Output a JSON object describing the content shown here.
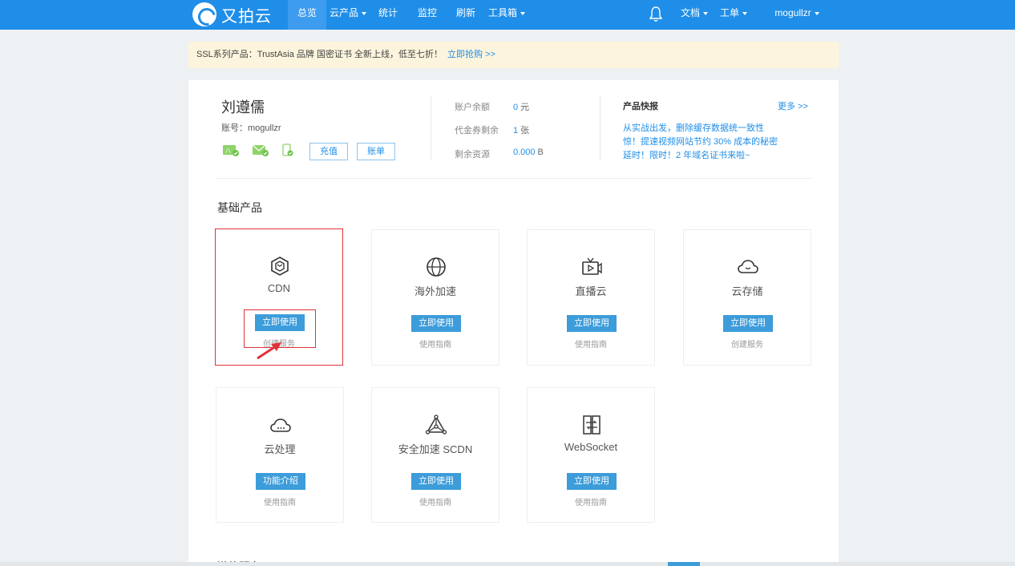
{
  "brand": {
    "name": "又拍云"
  },
  "nav": {
    "items": [
      {
        "label": "总览",
        "active": true,
        "dropdown": false
      },
      {
        "label": "云产品",
        "active": false,
        "dropdown": true
      },
      {
        "label": "统计",
        "active": false,
        "dropdown": false
      },
      {
        "label": "监控",
        "active": false,
        "dropdown": false
      },
      {
        "label": "刷新",
        "active": false,
        "dropdown": false
      },
      {
        "label": "工具箱",
        "active": false,
        "dropdown": true
      }
    ],
    "right": [
      {
        "label": "文档",
        "dropdown": true
      },
      {
        "label": "工单",
        "dropdown": true
      },
      {
        "label": "mogullzr",
        "dropdown": true
      }
    ]
  },
  "notice": {
    "text": "SSL系列产品：TrustAsia 品牌 国密证书 全新上线，低至七折！",
    "link": "立即抢购 >>"
  },
  "user": {
    "name": "刘遵儒",
    "account": "账号：mogullzr",
    "recharge_label": "充值",
    "bill_label": "账单"
  },
  "stats": [
    {
      "label": "账户余额",
      "value": "0",
      "unit": "元"
    },
    {
      "label": "代金券剩余",
      "value": "1",
      "unit": "张"
    },
    {
      "label": "剩余资源",
      "value": "0.000",
      "unit": "B"
    }
  ],
  "news": {
    "title": "产品快报",
    "more": "更多 >>",
    "lines": [
      "从实战出发，删除缓存数据统一致性",
      "惊！提速视频网站节约 30% 成本的秘密",
      "延时！限时！2 年域名证书来啦~"
    ]
  },
  "section": {
    "title": "基础产品"
  },
  "products": [
    {
      "name": "CDN",
      "button": "立即使用",
      "sub": "创建服务",
      "icon": "cdn-icon"
    },
    {
      "name": "海外加速",
      "button": "立即使用",
      "sub": "使用指南",
      "icon": "globe-icon"
    },
    {
      "name": "直播云",
      "button": "立即使用",
      "sub": "使用指南",
      "icon": "tv-icon"
    },
    {
      "name": "云存储",
      "button": "立即使用",
      "sub": "创建服务",
      "icon": "cloud-icon"
    },
    {
      "name": "云处理",
      "button": "功能介绍",
      "sub": "使用指南",
      "icon": "cloud-process-icon"
    },
    {
      "name": "安全加速 SCDN",
      "button": "立即使用",
      "sub": "使用指南",
      "icon": "triangle-network-icon"
    },
    {
      "name": "WebSocket",
      "button": "立即使用",
      "sub": "使用指南",
      "icon": "websocket-icon"
    }
  ],
  "bottom": {
    "title": "增值服务"
  },
  "colors": {
    "primary": "#1f8ee8",
    "button": "#3d9cda",
    "highlight": "#e0323a"
  }
}
